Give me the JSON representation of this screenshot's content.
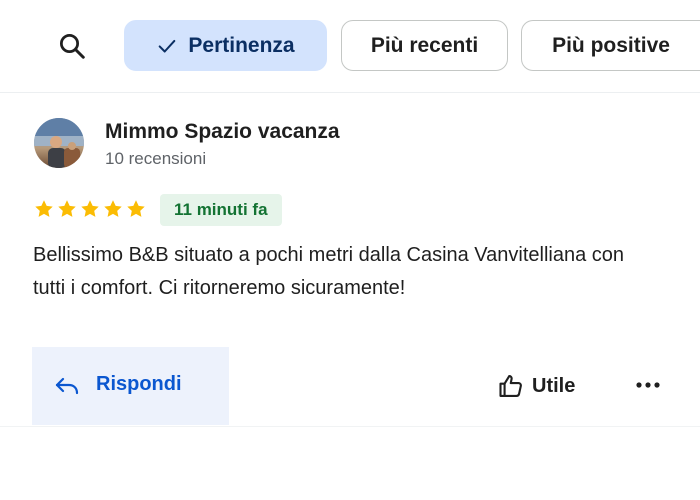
{
  "filters": {
    "search_icon": "search-icon",
    "chips": [
      {
        "label": "Pertinenza",
        "selected": true
      },
      {
        "label": "Più recenti",
        "selected": false
      },
      {
        "label": "Più positive",
        "selected": false
      }
    ]
  },
  "review": {
    "reviewer": {
      "name": "Mimmo Spazio vacanza",
      "reviews_count": "10 recensioni"
    },
    "rating": 5,
    "rating_max": 5,
    "time_ago": "11 minuti fa",
    "text": "Bellissimo B&B situato a pochi metri dalla Casina Vanvitelliana con tutti i comfort. Ci ritorneremo sicuramente!",
    "actions": {
      "reply_label": "Rispondi",
      "useful_label": "Utile"
    }
  },
  "colors": {
    "selected_chip_bg": "#d3e3fd",
    "accent_blue": "#0b57d0",
    "star_gold": "#fbbc04",
    "badge_green_bg": "#e6f4ea",
    "badge_green_text": "#137333"
  }
}
